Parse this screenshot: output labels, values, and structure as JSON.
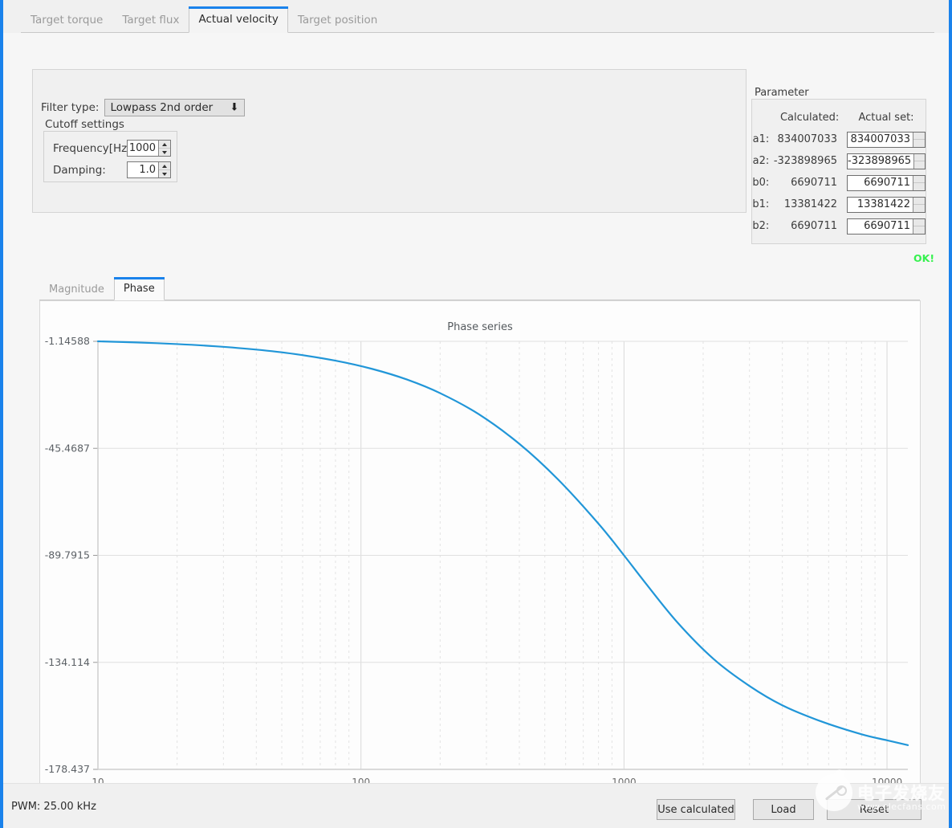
{
  "window": {
    "accent_color": "#1a82eb",
    "background": "#f0f0f0"
  },
  "tabs": [
    {
      "label": "Target torque",
      "active": false
    },
    {
      "label": "Target flux",
      "active": false
    },
    {
      "label": "Actual velocity",
      "active": true
    },
    {
      "label": "Target position",
      "active": false
    }
  ],
  "filter_panel": {
    "filter_type_label": "Filter type:",
    "filter_type_value": "Lowpass 2nd order",
    "dropdown_icon": "chevron-down-icon",
    "cutoff_group_title": "Cutoff settings",
    "frequency_label": "Frequency[Hz]:",
    "frequency_value": "1000",
    "damping_label": "Damping:",
    "damping_value": "1.0"
  },
  "parameter_panel": {
    "title": "Parameter",
    "col_calculated": "Calculated:",
    "col_actual_set": "Actual set:",
    "rows": [
      {
        "name": "a1:",
        "calculated": "834007033",
        "actual": "834007033"
      },
      {
        "name": "a2:",
        "calculated": "-323898965",
        "actual": "-323898965"
      },
      {
        "name": "b0:",
        "calculated": "6690711",
        "actual": "6690711"
      },
      {
        "name": "b1:",
        "calculated": "13381422",
        "actual": "13381422"
      },
      {
        "name": "b2:",
        "calculated": "6690711",
        "actual": "6690711"
      }
    ],
    "status_text": "OK!",
    "status_color": "#36f14f"
  },
  "chart_tabs": [
    {
      "label": "Magnitude",
      "active": false
    },
    {
      "label": "Phase",
      "active": true
    }
  ],
  "chart_data": {
    "type": "line",
    "title": "Phase series",
    "xlabel": "",
    "ylabel": "",
    "xscale": "log",
    "xlim": [
      10,
      12000
    ],
    "ylim": [
      -178.437,
      -1.14588
    ],
    "grid": true,
    "legend": false,
    "line_color": "#2196d8",
    "xticks": [
      10,
      100,
      1000,
      10000
    ],
    "xtick_labels": [
      "10",
      "100",
      "1000",
      "10000"
    ],
    "yticks": [
      -1.14588,
      -45.4687,
      -89.7915,
      -134.114,
      -178.437
    ],
    "ytick_labels": [
      "-1.14588",
      "-45.4687",
      "-89.7915",
      "-134.114",
      "-178.437"
    ],
    "series": [
      {
        "name": "Phase",
        "x": [
          10,
          14,
          20,
          28,
          40,
          56,
          80,
          110,
          150,
          200,
          280,
          400,
          560,
          800,
          1000,
          1200,
          1600,
          2200,
          3000,
          4000,
          5600,
          8000,
          10000,
          12000
        ],
        "y": [
          -1.146,
          -1.604,
          -2.292,
          -3.208,
          -4.583,
          -6.413,
          -9.15,
          -12.54,
          -17.02,
          -22.62,
          -31.28,
          -43.6,
          -58.24,
          -76.69,
          -89.79,
          -100.9,
          -117.7,
          -132.9,
          -143.9,
          -151.9,
          -158.5,
          -163.9,
          -166.4,
          -168.4
        ]
      }
    ]
  },
  "bottom_bar": {
    "pwm_status": "PWM: 25.00 kHz",
    "buttons": [
      {
        "label": "Use calculated"
      },
      {
        "label": "Load"
      },
      {
        "label": "Reset"
      }
    ]
  },
  "watermark": {
    "text_cn": "电子发烧友",
    "text_url": "www.elecfans.com"
  }
}
